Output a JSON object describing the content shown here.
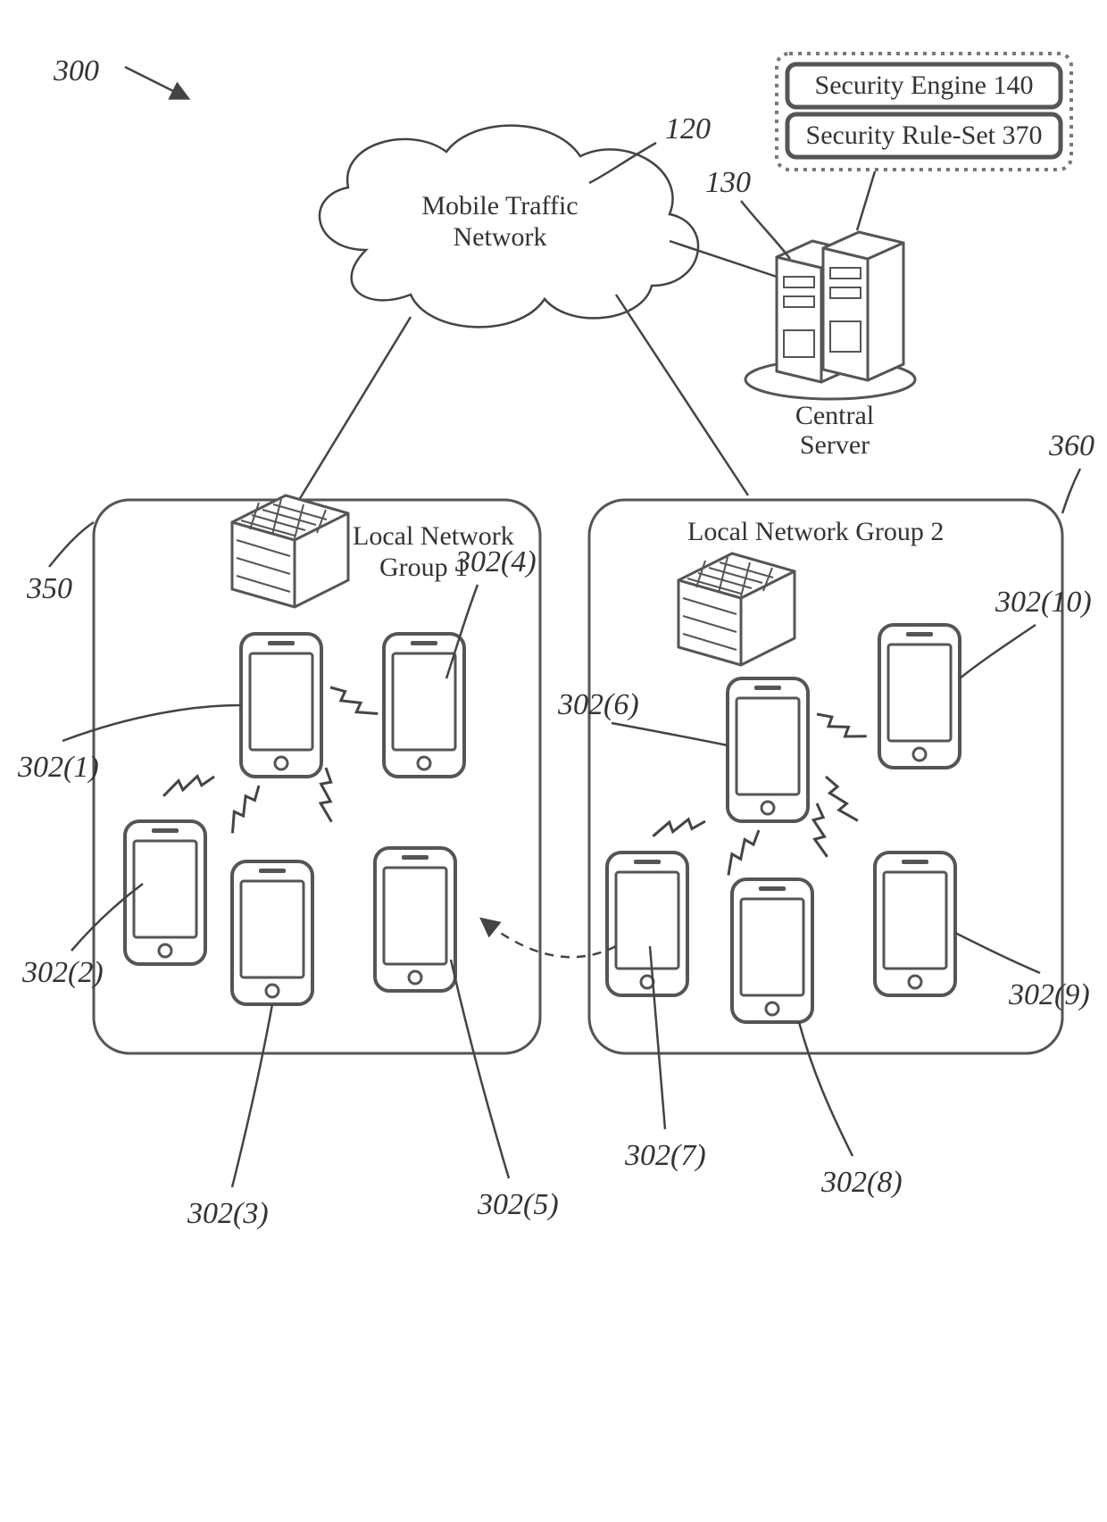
{
  "figure_ref": "300",
  "cloud": {
    "label_line1": "Mobile Traffic",
    "label_line2": "Network",
    "ref": "120"
  },
  "server": {
    "label_line1": "Central",
    "label_line2": "Server",
    "ref": "130"
  },
  "security": {
    "engine": "Security Engine 140",
    "ruleset": "Security Rule-Set 370"
  },
  "group1": {
    "title_line1": "Local Network",
    "title_line2": "Group 1",
    "ref": "350"
  },
  "group2": {
    "title": "Local Network Group 2",
    "ref": "360"
  },
  "devices": {
    "d1": "302(1)",
    "d2": "302(2)",
    "d3": "302(3)",
    "d4": "302(4)",
    "d5": "302(5)",
    "d6": "302(6)",
    "d7": "302(7)",
    "d8": "302(8)",
    "d9": "302(9)",
    "d10": "302(10)"
  }
}
